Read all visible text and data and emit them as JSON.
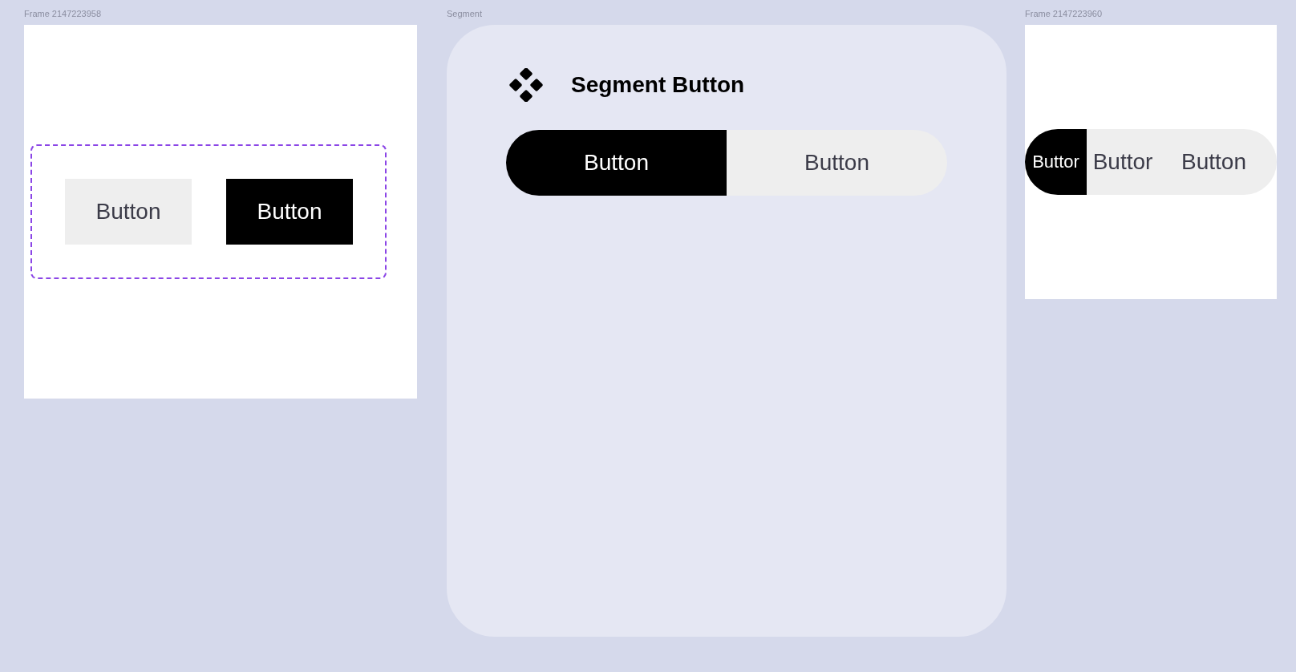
{
  "frames": [
    {
      "label": "Frame 2147223958",
      "kind": "buttons",
      "buttons": [
        {
          "label": "Button",
          "selected": false
        },
        {
          "label": "Button",
          "selected": true
        }
      ]
    },
    {
      "label": "Segment",
      "kind": "card",
      "title": "Segment Button",
      "segments": [
        {
          "label": "Button",
          "selected": true
        },
        {
          "label": "Button",
          "selected": false
        }
      ]
    },
    {
      "label": "Frame 2147223960",
      "kind": "pill",
      "segments": [
        {
          "label": "Buttor",
          "selected": true
        },
        {
          "label": "Buttor",
          "selected": false
        },
        {
          "label": "Button",
          "selected": false
        }
      ]
    }
  ]
}
